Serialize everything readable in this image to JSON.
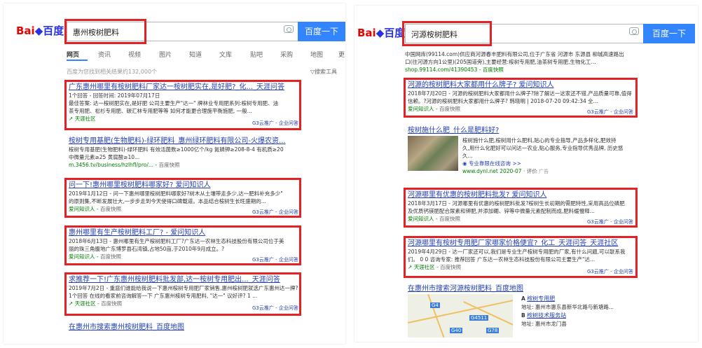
{
  "left": {
    "logo": {
      "text1": "Bai",
      "text2": "百度"
    },
    "search_query": "惠州桉树肥料",
    "search_button": "百度一下",
    "tabs": [
      "网页",
      "资讯",
      "视频",
      "图片",
      "知道",
      "文库",
      "贴吧",
      "采购",
      "地图",
      "更"
    ],
    "meta": "百度为您找到相关结果约132,000个",
    "tool": "搜索工具",
    "results": [
      {
        "title": "广东惠州哪里有桉树肥料厂家达一桉树肥实在,是好肥?_化..._天涯问答",
        "lines": [
          "1个回答 - 回答时间: 2019年07月17日",
          "最佳答案: 达一桉树肥实在,是好肥 公司主要生产\"达一\" 牌林业专用肥系列:桉树专用肥、油",
          "茶专用肥、松杉专用肥、碳汇林专用肥等等 如何才能更合理施平衡施肥, 一般..."
        ],
        "source": "天涯社区",
        "badge": "G3云推广 - 企业问答"
      },
      {
        "title": "桉树专用基肥(生物肥料)-绿环肥料_惠州绿环肥料有限公司-火爆农资...",
        "lines": [
          "桉树专用基肥(生物肥料)-绿环肥料 有效活菌数≥1000亿个/kg 氮磷钾≥208-8-4 有机质≥20",
          "中微量元素≥25 黄腐酸≥10..."
        ],
        "url": "m.3456.tv/business/hzlhfl/pro/...",
        "snapshot": "百度快照"
      },
      {
        "title": "问一下!惠州哪里桉树肥料哪家好? 爱问知识人",
        "lines": [
          "2019年1月12日 - 问一下惠州哪里桉树肥料哪家好?树木从土壤带走多少,达一肥料补充多少\"",
          "的原则集,不断发展壮大,一步步走到今天使得口碑载道。本品结合桉树生长旺盛期的..."
        ],
        "source": "爱问知识人",
        "snapshot": "百度快照",
        "badge": "G3云推广 - 企业问答"
      },
      {
        "title": "惠州哪里有生产桉树肥料工厂? - 爱问知识人",
        "lines": [
          "2018年6月13日 - 惠州哪里有生产桉树肥料工厂?广东达一农林生态科技股份有限公司位于美",
          "丽的珠三角腹地广东博罗县石湾镇,占地50亩,于2010年9月成立。?"
        ],
        "source": "爱问知识人",
        "snapshot": "百度快照",
        "badge": "G3云推广 - 企业问答"
      },
      {
        "title": "求推荐一下!广东惠州桉树肥料批发部,达一桉树专用肥出..._天涯问答",
        "lines": [
          "2019年7月2日 - 重庭们谁能给我说一下惠州桉树专用肥厂家销售,惠州桉树肥就选广东惠州达一牌?",
          "1个回答 在线的看家前咨询解答一下 广东惠州桉树专用肥料, \"达一\" 议好评? 1 ..."
        ],
        "source": "天涯社区",
        "snapshot": "百度快照",
        "badge": "G3云推广 - 企业问答"
      }
    ],
    "bottom_link": "在惠州市搜索惠州桉树肥料_百度地图"
  },
  "right": {
    "logo": {
      "text1": "Bai",
      "text2": "百度"
    },
    "search_query": "河源桉树肥料",
    "search_button": "百度一下",
    "top_snippet": [
      "中国网库(99114.com)供应商河源春丰肥料有限公司,位于广东省 河源市 东源县 柳城高速路出",
      "口(往河源方向1公里)(205国道旁),主要经营:桉树专用肥,油茶树专用肥,生物化工..."
    ],
    "top_url": "shop.99114.com/41390453 - 百度快照",
    "results": [
      {
        "title": "河源的桉树肥料大家都用什么牌子? 爱问知识人",
        "lines": [
          "2018年7月20日 - 河源的桉树肥料大家都用什么牌子?除了解达一这家还不错,产品质量可靠,值得",
          "信赖。?河源的桉树肥料大家都用什么牌子? 韩晓明 | 2018-07-20 09:42:34 全..."
        ],
        "source": "爱问知识人",
        "snapshot": "百度快照",
        "badge": "G3云推广 - 企业问答"
      },
      {
        "title": "桉树施什么肥_什么是肥料好?",
        "lines": [
          "桉树施什么肥,桉树用什么肥料,贴心的专业指导,产品多样化,肥效持",
          "久,用什么化肥好可以问达一农业,贴心服务,专业指导优秀品牌, 历史悠",
          "久..."
        ],
        "link2": "专业靠限在线咨询 >>",
        "url": "www.dynl.net 2020-07",
        "rating": "评价",
        "ad": "广告"
      },
      {
        "title": "河源哪里有优惠的桉树肥料批发? 爱问知识人",
        "lines": [
          "2018年3月17日 - 河源哪里有优惠的桉树肥料批发?桉树生长初期的需肥特性,采用高品位磷肥",
          "及优质钙镁肥配合尿素和钾肥,并添加硼、锌等中微量元素配制而成,肥料缓慢释..."
        ],
        "source": "爱问知识人",
        "snapshot": "百度快照",
        "badge": "G3云推广 - 企业问答"
      },
      {
        "title": "河源哪里有桉树专用肥厂家哪家价格便宜?_化工_天涯问答_天涯社区",
        "lines": [
          "2019年4月29日 - 达一厂家还可以,我们是专业生产桉树专用肥的厂家,有什么问题,可以联系我",
          "们。  0 0 咨询专家: 推荐回答 广东达一农林生态科技股份有限公司主要生产\"达..."
        ],
        "source": "天涯社区",
        "snapshot": "百度快照",
        "badge": "G3云推广 - 企业问答"
      }
    ],
    "map_link": "在惠州市搜索河源桉树肥料_百度地图",
    "map_entries": [
      {
        "letter": "A",
        "name": "桉树专用肥",
        "addr": "地址: 惠州市惠东县新华北路与新塘路..."
      },
      {
        "letter": "B",
        "name": "桉树技术服务站",
        "addr": "地址: 惠州市龙门县"
      }
    ],
    "map_labels": [
      "G4",
      "G4511",
      "G78",
      "G40"
    ]
  },
  "colors": {
    "brand_red": "#e10602",
    "brand_blue": "#2932e1",
    "button": "#3385ff",
    "link": "#2440b3",
    "highlight": "#c00",
    "green_url": "#008000",
    "annotation_box": "#e32226"
  }
}
